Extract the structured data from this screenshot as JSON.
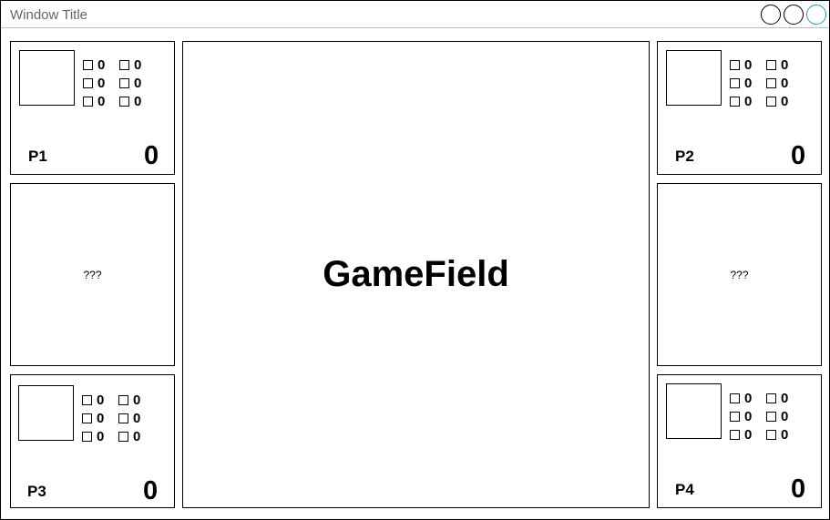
{
  "window": {
    "title": "Window Title",
    "buttons": [
      "circle-button",
      "circle-button",
      "circle-button"
    ],
    "accent_color": "#1e9bd7"
  },
  "players": {
    "p1": {
      "name": "P1",
      "score": "0",
      "stats": [
        "0",
        "0",
        "0",
        "0",
        "0",
        "0"
      ]
    },
    "p2": {
      "name": "P2",
      "score": "0",
      "stats": [
        "0",
        "0",
        "0",
        "0",
        "0",
        "0"
      ]
    },
    "p3": {
      "name": "P3",
      "score": "0",
      "stats": [
        "0",
        "0",
        "0",
        "0",
        "0",
        "0"
      ]
    },
    "p4": {
      "name": "P4",
      "score": "0",
      "stats": [
        "0",
        "0",
        "0",
        "0",
        "0",
        "0"
      ]
    }
  },
  "side_panels": {
    "left": "???",
    "right": "???"
  },
  "gamefield": {
    "label": "GameField"
  }
}
